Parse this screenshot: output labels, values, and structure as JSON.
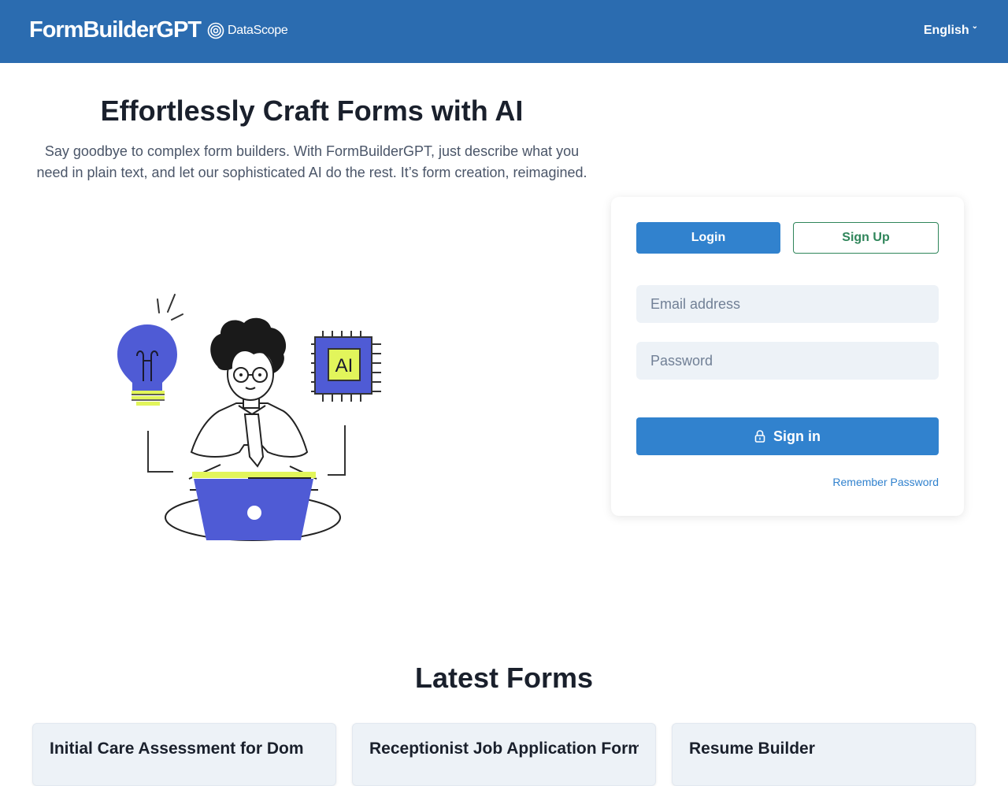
{
  "header": {
    "brand": "FormBuilderGPT",
    "partner": "DataScope",
    "language": "English",
    "bg_color": "#2b6cb0"
  },
  "hero": {
    "title": "Effortlessly Craft Forms with AI",
    "description": "Say goodbye to complex form builders. With FormBuilderGPT, just describe what you need in plain text, and let our sophisticated AI do the rest. It’s form creation, reimagined.",
    "illustration_chip_label": "AI"
  },
  "auth": {
    "login_tab": "Login",
    "signup_tab": "Sign Up",
    "email_placeholder": "Email address",
    "password_placeholder": "Password",
    "signin_label": "Sign in",
    "signin_icon": "lock-icon",
    "remember_label": "Remember Password",
    "primary_color": "#3182ce",
    "secondary_color": "#2f855a"
  },
  "latest": {
    "title": "Latest Forms",
    "forms": [
      {
        "title": "Initial Care Assessment for Dom"
      },
      {
        "title": "Receptionist Job Application Form"
      },
      {
        "title": "Resume Builder"
      }
    ]
  }
}
